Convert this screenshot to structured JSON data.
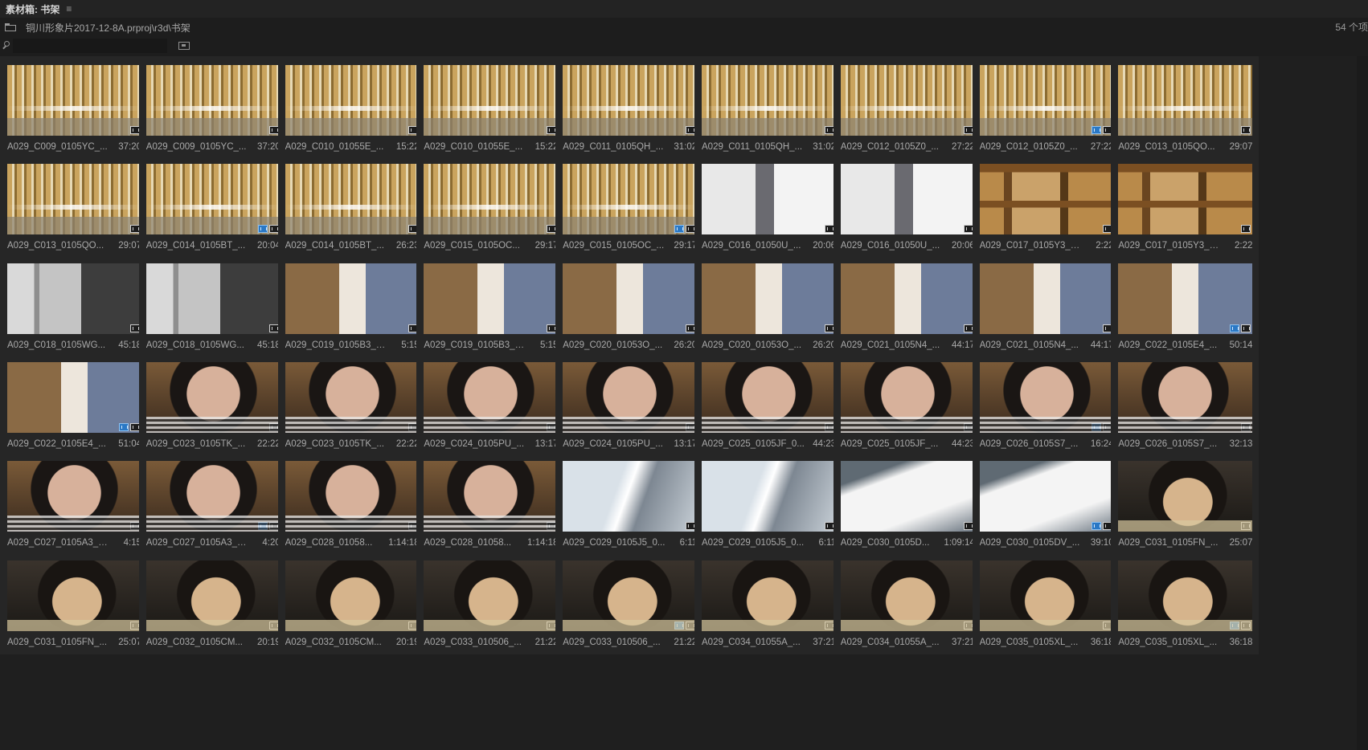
{
  "window": {
    "title": "素材箱: 书架",
    "menu_glyph": "≡",
    "path": "铜川形象片2017-12-8A.prproj\\r3d\\书架",
    "item_count": "54 个项"
  },
  "search": {
    "value": ""
  },
  "clips": [
    {
      "name": "A029_C009_0105YC_...",
      "duration": "37:20",
      "thumb": "shelf",
      "has_proxy": false
    },
    {
      "name": "A029_C009_0105YC_...",
      "duration": "37:20",
      "thumb": "shelf",
      "has_proxy": false
    },
    {
      "name": "A029_C010_01055E_...",
      "duration": "15:22",
      "thumb": "shelf",
      "has_proxy": false
    },
    {
      "name": "A029_C010_01055E_...",
      "duration": "15:22",
      "thumb": "shelf",
      "has_proxy": false
    },
    {
      "name": "A029_C011_0105QH_...",
      "duration": "31:02",
      "thumb": "shelf",
      "has_proxy": false
    },
    {
      "name": "A029_C011_0105QH_...",
      "duration": "31:02",
      "thumb": "shelf",
      "has_proxy": false
    },
    {
      "name": "A029_C012_0105Z0_...",
      "duration": "27:22",
      "thumb": "shelf",
      "has_proxy": false
    },
    {
      "name": "A029_C012_0105Z0_...",
      "duration": "27:22",
      "thumb": "shelf",
      "has_proxy": true
    },
    {
      "name": "A029_C013_0105QO...",
      "duration": "29:07",
      "thumb": "shelf",
      "has_proxy": false
    },
    {
      "name": "A029_C013_0105QO...",
      "duration": "29:07",
      "thumb": "shelf",
      "has_proxy": false
    },
    {
      "name": "A029_C014_0105BT_...",
      "duration": "20:04",
      "thumb": "shelf",
      "has_proxy": true
    },
    {
      "name": "A029_C014_0105BT_...",
      "duration": "26:23",
      "thumb": "shelf",
      "has_proxy": false
    },
    {
      "name": "A029_C015_0105OC...",
      "duration": "29:17",
      "thumb": "shelf",
      "has_proxy": false
    },
    {
      "name": "A029_C015_0105OC_...",
      "duration": "29:17",
      "thumb": "shelf",
      "has_proxy": true
    },
    {
      "name": "A029_C016_01050U_...",
      "duration": "20:06",
      "thumb": "window",
      "has_proxy": false
    },
    {
      "name": "A029_C016_01050U_...",
      "duration": "20:06",
      "thumb": "window",
      "has_proxy": false
    },
    {
      "name": "A029_C017_0105Y3_0...",
      "duration": "2:22",
      "thumb": "wood",
      "has_proxy": false
    },
    {
      "name": "A029_C017_0105Y3_0...",
      "duration": "2:22",
      "thumb": "wood",
      "has_proxy": false
    },
    {
      "name": "A029_C018_0105WG...",
      "duration": "45:18",
      "thumb": "studio",
      "has_proxy": false
    },
    {
      "name": "A029_C018_0105WG...",
      "duration": "45:18",
      "thumb": "studio",
      "has_proxy": false
    },
    {
      "name": "A029_C019_0105B3_0...",
      "duration": "5:15",
      "thumb": "girl",
      "has_proxy": false
    },
    {
      "name": "A029_C019_0105B3_0...",
      "duration": "5:15",
      "thumb": "girl",
      "has_proxy": false
    },
    {
      "name": "A029_C020_01053O_...",
      "duration": "26:20",
      "thumb": "girl",
      "has_proxy": false
    },
    {
      "name": "A029_C020_01053O_...",
      "duration": "26:20",
      "thumb": "girl",
      "has_proxy": false
    },
    {
      "name": "A029_C021_0105N4_...",
      "duration": "44:17",
      "thumb": "girl",
      "has_proxy": false
    },
    {
      "name": "A029_C021_0105N4_...",
      "duration": "44:17",
      "thumb": "girl",
      "has_proxy": false
    },
    {
      "name": "A029_C022_0105E4_...",
      "duration": "50:14",
      "thumb": "girl",
      "has_proxy": true
    },
    {
      "name": "A029_C022_0105E4_...",
      "duration": "51:04",
      "thumb": "girl",
      "has_proxy": true
    },
    {
      "name": "A029_C023_0105TK_...",
      "duration": "22:22",
      "thumb": "face",
      "has_proxy": false
    },
    {
      "name": "A029_C023_0105TK_...",
      "duration": "22:22",
      "thumb": "face",
      "has_proxy": false
    },
    {
      "name": "A029_C024_0105PU_...",
      "duration": "13:17",
      "thumb": "face",
      "has_proxy": false
    },
    {
      "name": "A029_C024_0105PU_...",
      "duration": "13:17",
      "thumb": "face",
      "has_proxy": false
    },
    {
      "name": "A029_C025_0105JF_0...",
      "duration": "44:23",
      "thumb": "face",
      "has_proxy": false
    },
    {
      "name": "A029_C025_0105JF_...",
      "duration": "44:23",
      "thumb": "face",
      "has_proxy": false
    },
    {
      "name": "A029_C026_0105S7_...",
      "duration": "16:24",
      "thumb": "face",
      "has_proxy": true
    },
    {
      "name": "A029_C026_0105S7_...",
      "duration": "32:13",
      "thumb": "face",
      "has_proxy": false
    },
    {
      "name": "A029_C027_0105A3_0...",
      "duration": "4:15",
      "thumb": "face",
      "has_proxy": false
    },
    {
      "name": "A029_C027_0105A3_0...",
      "duration": "4:20",
      "thumb": "face",
      "has_proxy": true
    },
    {
      "name": "A029_C028_01058...",
      "duration": "1:14:18",
      "thumb": "face",
      "has_proxy": false
    },
    {
      "name": "A029_C028_01058...",
      "duration": "1:14:18",
      "thumb": "face",
      "has_proxy": false
    },
    {
      "name": "A029_C029_0105J5_0...",
      "duration": "6:11",
      "thumb": "blur",
      "has_proxy": false
    },
    {
      "name": "A029_C029_0105J5_0...",
      "duration": "6:11",
      "thumb": "blur",
      "has_proxy": false
    },
    {
      "name": "A029_C030_0105D...",
      "duration": "1:09:14",
      "thumb": "paper",
      "has_proxy": false
    },
    {
      "name": "A029_C030_0105DV_...",
      "duration": "39:10",
      "thumb": "paper",
      "has_proxy": true
    },
    {
      "name": "A029_C031_0105FN_...",
      "duration": "25:07",
      "thumb": "child",
      "has_proxy": false
    },
    {
      "name": "A029_C031_0105FN_...",
      "duration": "25:07",
      "thumb": "child",
      "has_proxy": false
    },
    {
      "name": "A029_C032_0105CM...",
      "duration": "20:19",
      "thumb": "child",
      "has_proxy": false
    },
    {
      "name": "A029_C032_0105CM...",
      "duration": "20:19",
      "thumb": "child",
      "has_proxy": false
    },
    {
      "name": "A029_C033_010506_...",
      "duration": "21:22",
      "thumb": "child",
      "has_proxy": false
    },
    {
      "name": "A029_C033_010506_...",
      "duration": "21:22",
      "thumb": "child",
      "has_proxy": true
    },
    {
      "name": "A029_C034_01055A_...",
      "duration": "37:21",
      "thumb": "child",
      "has_proxy": false
    },
    {
      "name": "A029_C034_01055A_...",
      "duration": "37:21",
      "thumb": "child",
      "has_proxy": false
    },
    {
      "name": "A029_C035_0105XL_...",
      "duration": "36:18",
      "thumb": "child",
      "has_proxy": false
    },
    {
      "name": "A029_C035_0105XL_...",
      "duration": "36:18",
      "thumb": "child",
      "has_proxy": true
    }
  ]
}
